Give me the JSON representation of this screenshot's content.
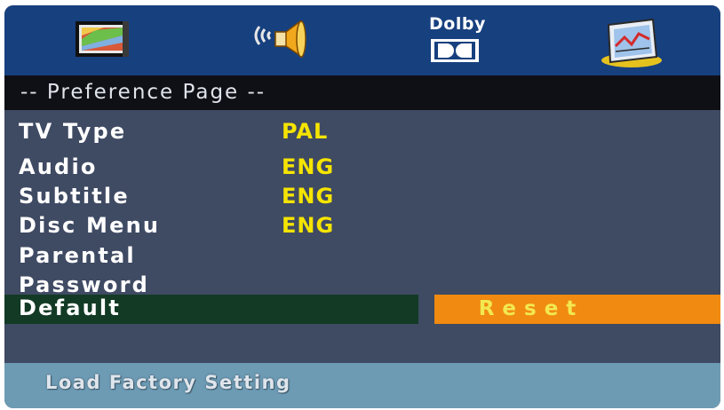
{
  "tabs": [
    {
      "icon": "picture-icon"
    },
    {
      "icon": "speaker-icon"
    },
    {
      "icon": "dolby-icon",
      "label": "Dolby"
    },
    {
      "icon": "preference-icon"
    }
  ],
  "page_title": "-- Preference Page --",
  "menu": {
    "items": [
      {
        "label": "TV Type",
        "value": "PAL"
      },
      {
        "label": "Audio",
        "value": "ENG"
      },
      {
        "label": "Subtitle",
        "value": "ENG"
      },
      {
        "label": "Disc Menu",
        "value": "ENG"
      },
      {
        "label": "Parental",
        "value": ""
      },
      {
        "label": "Password",
        "value": ""
      },
      {
        "label": "Default",
        "value": ""
      }
    ],
    "selected": "Default"
  },
  "reset_button": {
    "label": "Reset"
  },
  "status": {
    "text": "Load Factory Setting"
  },
  "colors": {
    "topbar": "#17407f",
    "menu_background": "#3f4a63",
    "selected_row": "#123a24",
    "reset_button": "#f08a10",
    "value_text": "#f5e400",
    "status_bar": "#6d9bb4"
  }
}
